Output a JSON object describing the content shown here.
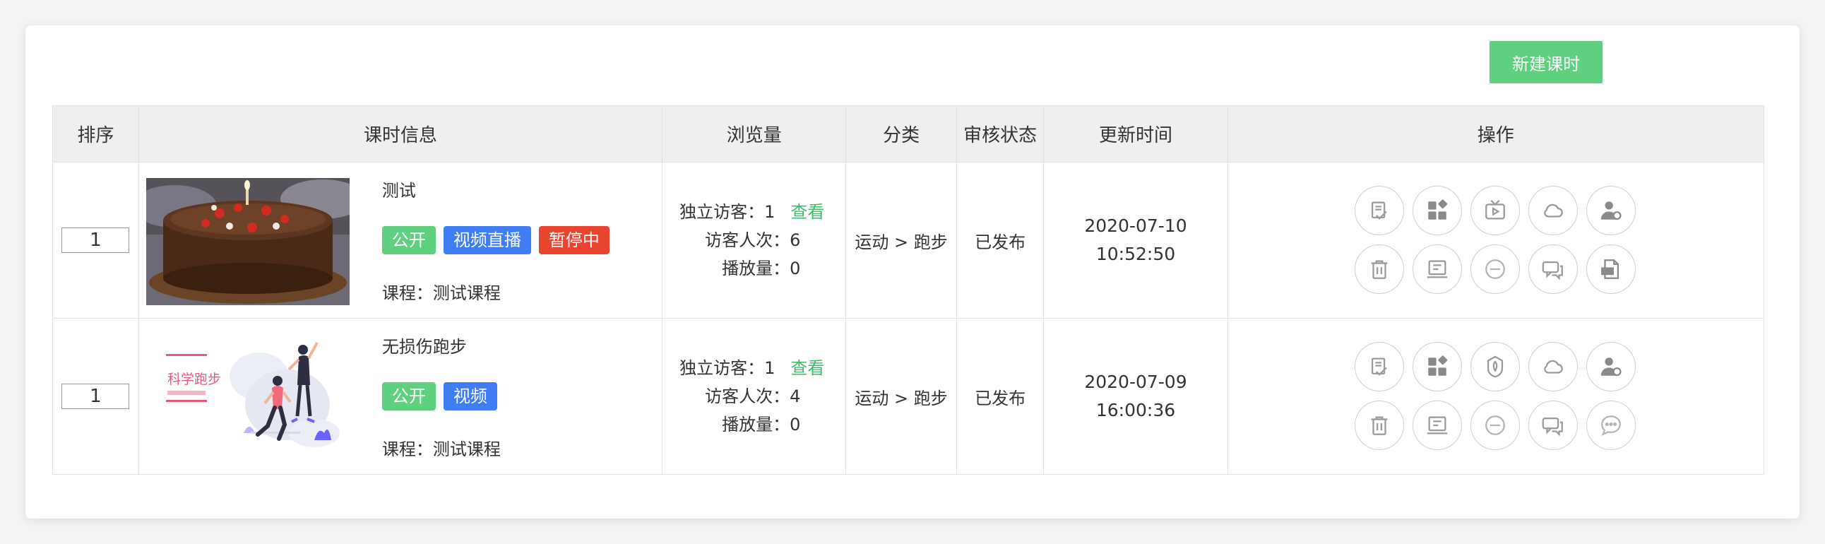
{
  "toolbar": {
    "new_button": "新建课时"
  },
  "table": {
    "headers": [
      "排序",
      "课时信息",
      "浏览量",
      "分类",
      "审核状态",
      "更新时间",
      "操作"
    ],
    "rows": [
      {
        "sort": "1",
        "thumb": "cake-photo",
        "title": "测试",
        "tags": [
          {
            "label": "公开",
            "color": "#5fcf80"
          },
          {
            "label": "视频直播",
            "color": "#3d7ef5"
          },
          {
            "label": "暂停中",
            "color": "#e9442e"
          }
        ],
        "course": "课程：测试课程",
        "uv_label": "独立访客：",
        "uv_value": "1",
        "view_link": "查看",
        "pv_label": "访客人次：",
        "pv_value": "6",
        "play_label": "播放量：",
        "play_value": "0",
        "category": "运动 > 跑步",
        "status": "已发布",
        "date": "2020-07-10",
        "time": "10:52:50",
        "ops": [
          "approve-icon",
          "apps-icon",
          "live-tv-icon",
          "cloud-icon",
          "user-settings-icon",
          "delete-icon",
          "book-icon",
          "disable-icon",
          "comments-icon",
          "file-export-icon"
        ]
      },
      {
        "sort": "1",
        "thumb": "running-illustration",
        "thumb_text": "科学跑步",
        "title": "无损伤跑步",
        "tags": [
          {
            "label": "公开",
            "color": "#5fcf80"
          },
          {
            "label": "视频",
            "color": "#3d7ef5"
          }
        ],
        "course": "课程：测试课程",
        "uv_label": "独立访客：",
        "uv_value": "1",
        "view_link": "查看",
        "pv_label": "访客人次：",
        "pv_value": "4",
        "play_label": "播放量：",
        "play_value": "0",
        "category": "运动 > 跑步",
        "status": "已发布",
        "date": "2020-07-09",
        "time": "16:00:36",
        "ops": [
          "approve-icon",
          "apps-icon",
          "badge-icon",
          "cloud-icon",
          "user-settings-icon",
          "delete-icon",
          "book-icon",
          "disable-icon",
          "comments-icon",
          "chat-bubble-icon"
        ]
      }
    ]
  },
  "colors": {
    "accent_green": "#5fcf80",
    "tag_blue": "#3d7ef5",
    "tag_red": "#e9442e",
    "header_bg": "#efefef"
  }
}
